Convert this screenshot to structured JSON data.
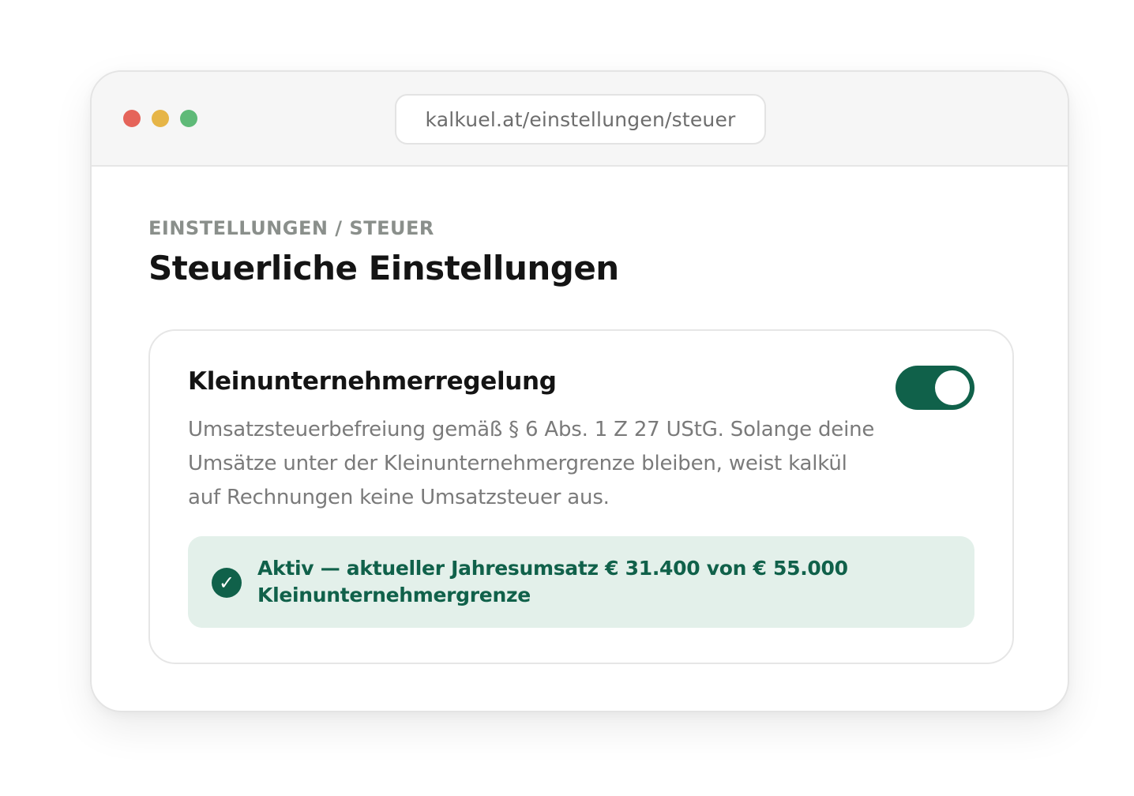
{
  "browser": {
    "url": "kalkuel.at/einstellungen/steuer",
    "dot_colors": {
      "red": "#e5645a",
      "yellow": "#e6b547",
      "green": "#5fba78"
    }
  },
  "header": {
    "breadcrumb": "EINSTELLUNGEN / STEUER",
    "title": "Steuerliche Einstellungen"
  },
  "card": {
    "title": "Kleinunternehmerregelung",
    "description": "Umsatzsteuerbefreiung gemäß § 6 Abs. 1 Z 27 UStG. Solange deine Umsätze unter der Kleinunternehmergrenze bleiben, weist kalkül auf Rechnungen keine Umsatzsteuer aus.",
    "toggle_on": true,
    "status": {
      "icon": "check-icon",
      "glyph": "✓",
      "text": "Aktiv — aktueller Jahresumsatz € 31.400 von € 55.000 Kleinunternehmergrenze"
    }
  },
  "colors": {
    "accent": "#10614a",
    "status_bg": "#e3f0ea"
  }
}
